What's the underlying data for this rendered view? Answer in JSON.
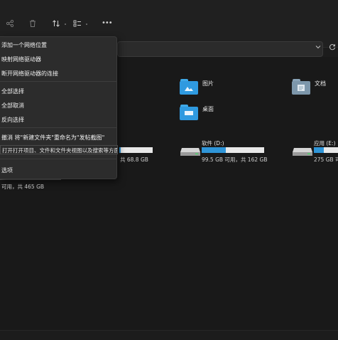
{
  "toolbar": {
    "share_icon": "share-icon",
    "delete_icon": "trash-icon",
    "sort_icon": "sort-icon",
    "view_icon": "view-icon",
    "more_icon": "more-icon",
    "chevron": "˅",
    "more": "•••"
  },
  "menu": {
    "items": [
      "添加一个网络位置",
      "映射网络驱动器",
      "断开网络驱动器的连接",
      "全部选择",
      "全部取消",
      "反向选择",
      "撤消 将\"新建文件夹\"重命名为\"发帖截图\"",
      "选项"
    ],
    "tooltip": "打开打开项目、文件和文件夹视图以及搜索等方面的"
  },
  "quick_access": [
    {
      "label": "图片",
      "icon": "pictures-folder-icon"
    },
    {
      "label": "文档",
      "icon": "documents-folder-icon"
    },
    {
      "label": "桌面",
      "icon": "desktop-folder-icon"
    }
  ],
  "drives": [
    {
      "name": "",
      "free_text": "共 68.8 GB",
      "used_fraction": 0.05
    },
    {
      "name": "软件 (D:)",
      "free_text": "99.5 GB 可用，共 162 GB",
      "used_fraction": 0.39
    },
    {
      "name": "应用 (E:)",
      "free_text": "275 GB 可",
      "used_fraction": 0.4
    }
  ],
  "left_drive": {
    "free_text": "可用，共 465 GB"
  },
  "colors": {
    "accent": "#2f95d8",
    "folder": "#2f9ae0",
    "background": "#191919"
  }
}
